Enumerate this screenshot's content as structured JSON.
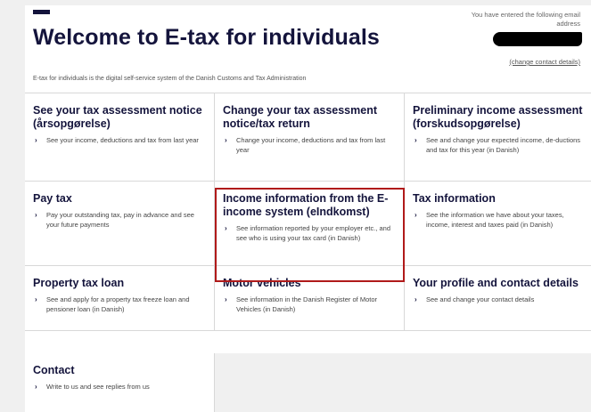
{
  "header": {
    "title": "Welcome to E-tax for individuals",
    "subtitle": "E-tax for individuals is the digital self-service system of the Danish Customs and Tax Administration",
    "email_notice": "You have entered the following email address",
    "change_contact_link": "(change contact details)"
  },
  "tiles": [
    {
      "title": "See your tax assessment notice (årsopgørelse)",
      "desc": "See your income, deductions and tax from last year"
    },
    {
      "title": "Change your tax assessment notice/tax return",
      "desc": "Change your income, deductions and tax from last year"
    },
    {
      "title": "Preliminary income assessment (forskudsopgørelse)",
      "desc": "See and change your expected income, de-ductions and tax for this year (in Danish)"
    },
    {
      "title": "Pay tax",
      "desc": "Pay your outstanding tax, pay in advance and see your future payments"
    },
    {
      "title": "Income information from the E-income system (eIndkomst)",
      "desc": "See information reported by your employer etc., and see who is using your tax card (in Danish)"
    },
    {
      "title": "Tax information",
      "desc": "See the information we have about your taxes, income, interest and taxes paid (in Danish)"
    },
    {
      "title": "Property tax loan",
      "desc": "See and apply for a property tax freeze loan and pensioner loan (in Danish)"
    },
    {
      "title": "Motor vehicles",
      "desc": "See information in the Danish Register of Motor Vehicles (in Danish)"
    },
    {
      "title": "Your profile and contact details",
      "desc": "See and change your contact details"
    },
    {
      "title": "Contact",
      "desc": "Write to us and see replies from us"
    }
  ],
  "icons": {
    "chevron": "›"
  },
  "colors": {
    "brand": "#14143c",
    "highlight": "#b01a1a"
  }
}
